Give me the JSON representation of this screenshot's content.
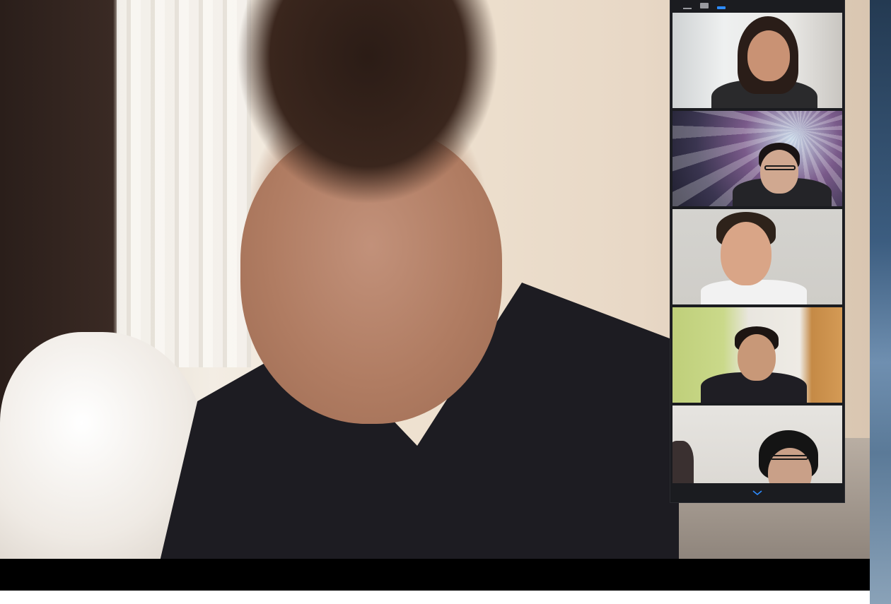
{
  "window": {
    "accent_color": "#2d8cff",
    "panel_color": "#1b1c20",
    "bar_color": "#000000"
  },
  "main_speaker": {
    "description_icon": "active-speaker-video"
  },
  "gallery": {
    "header_icons": [
      "minimize-icon",
      "speaker-view-icon",
      "strip-view-icon"
    ],
    "tiles": [
      {
        "icon": "participant-video"
      },
      {
        "icon": "participant-video"
      },
      {
        "icon": "participant-video"
      },
      {
        "icon": "participant-video"
      },
      {
        "icon": "participant-video"
      }
    ],
    "footer_icon": "chevron-down-icon"
  }
}
